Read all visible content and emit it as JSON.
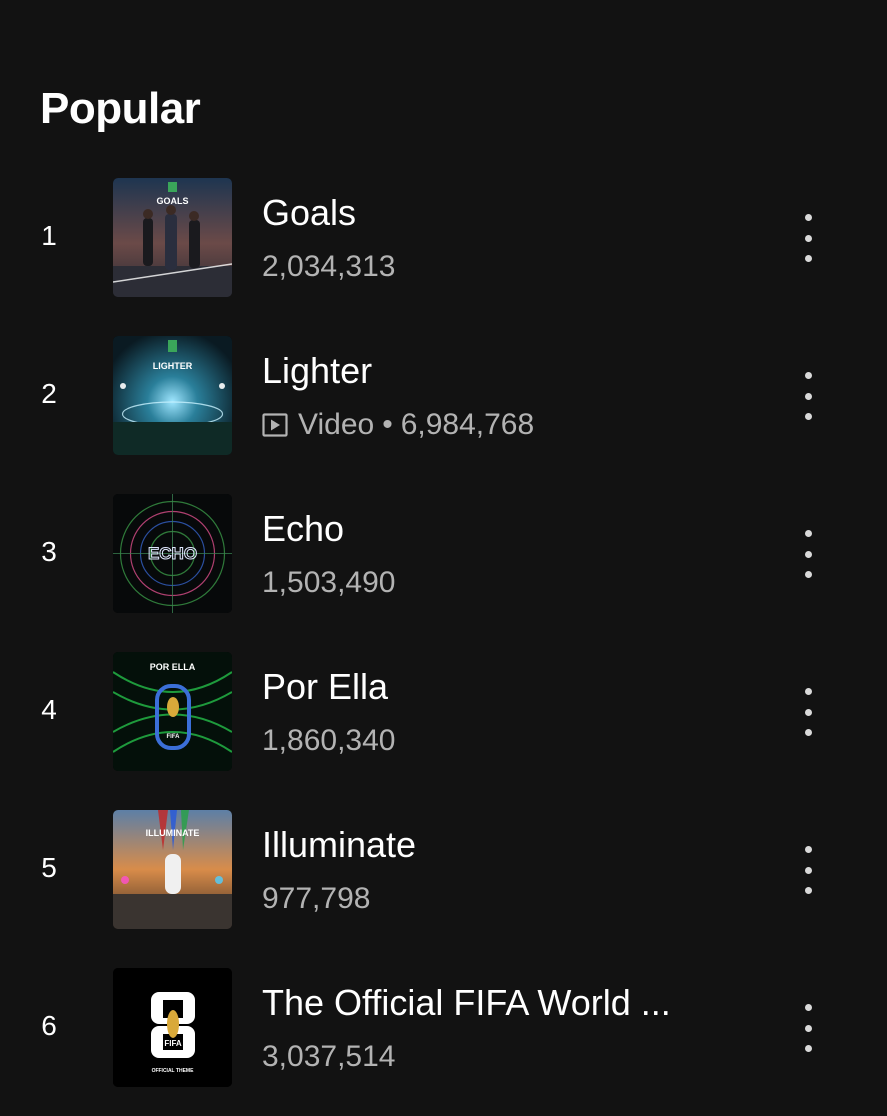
{
  "section": {
    "title": "Popular"
  },
  "tracks": [
    {
      "rank": "1",
      "title": "Goals",
      "plays": "2,034,313",
      "is_video": false,
      "cover": {
        "icon": "goals-cover-art",
        "label": "GOALS"
      }
    },
    {
      "rank": "2",
      "title": "Lighter",
      "plays": "6,984,768",
      "is_video": true,
      "video_label": "Video",
      "separator": "•",
      "cover": {
        "icon": "lighter-cover-art",
        "label": "LIGHTER"
      }
    },
    {
      "rank": "3",
      "title": "Echo",
      "plays": "1,503,490",
      "is_video": false,
      "cover": {
        "icon": "echo-cover-art",
        "label": "ECHO"
      }
    },
    {
      "rank": "4",
      "title": "Por Ella",
      "plays": "1,860,340",
      "is_video": false,
      "cover": {
        "icon": "por-ella-cover-art",
        "label": "POR ELLA",
        "sublabel": "FIFA"
      }
    },
    {
      "rank": "5",
      "title": "Illuminate",
      "plays": "977,798",
      "is_video": false,
      "cover": {
        "icon": "illuminate-cover-art",
        "label": "ILLUMINATE"
      }
    },
    {
      "rank": "6",
      "title": "The Official FIFA World ...",
      "plays": "3,037,514",
      "is_video": false,
      "cover": {
        "icon": "fifa-theme-cover-art",
        "label": "FIFA",
        "sublabel": "OFFICIAL THEME"
      }
    }
  ],
  "colors": {
    "background": "#121212",
    "title": "#ffffff",
    "subtitle": "#b3b3b3",
    "accent_green": "#1db954"
  },
  "icons": {
    "more": "more-vertical-icon",
    "video": "video-play-icon"
  }
}
